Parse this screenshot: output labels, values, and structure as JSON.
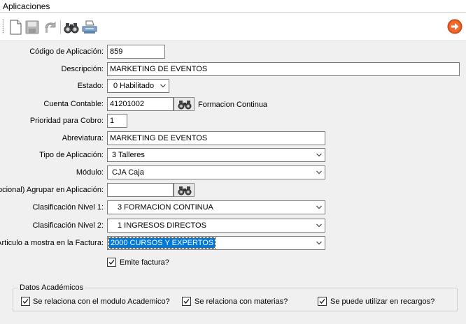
{
  "window": {
    "title": "Aplicaciones"
  },
  "toolbar": {
    "buttons": [
      {
        "name": "new-document-icon"
      },
      {
        "name": "save-icon"
      },
      {
        "name": "undo-icon"
      },
      {
        "name": "binoculars-icon"
      },
      {
        "name": "print-icon"
      }
    ],
    "next": {
      "name": "next-arrow-icon"
    }
  },
  "form": {
    "codigo": {
      "label": "Código de Aplicación:",
      "value": "859"
    },
    "descripcion": {
      "label": "Descripción:",
      "value": "MARKETING DE EVENTOS"
    },
    "estado": {
      "label": "Estado:",
      "value": "0 Habilitado"
    },
    "cuenta": {
      "label": "Cuenta Contable:",
      "value": "41201002",
      "desc": "Formacion Continua"
    },
    "prioridad": {
      "label": "Prioridad para Cobro:",
      "value": "1"
    },
    "abreviatura": {
      "label": "Abreviatura:",
      "value": "MARKETING DE EVENTOS"
    },
    "tipo": {
      "label": "Tipo de Aplicación:",
      "value": "3  Talleres"
    },
    "modulo": {
      "label": "Módulo:",
      "value": "CJA  Caja"
    },
    "agrupar": {
      "label": "(Opcional) Agrupar en Aplicación:",
      "value": ""
    },
    "clasif1": {
      "label": "Clasificación Nivel 1:",
      "value": "3  FORMACION CONTINUA"
    },
    "clasif2": {
      "label": "Clasificación Nivel 2:",
      "value": "1  INGRESOS DIRECTOS"
    },
    "articulo": {
      "label": "Articulo a mostra en la Factura:",
      "value": "2000  CURSOS Y EXPERTOS"
    },
    "emite": {
      "label": "Emite factura?",
      "checked": true
    }
  },
  "academic": {
    "title": "Datos Académicos",
    "checks": [
      {
        "label": "Se relaciona con el modulo Academico?",
        "checked": true
      },
      {
        "label": "Se relaciona con materias?",
        "checked": true
      },
      {
        "label": "Se puede utilizar en recargos?",
        "checked": true
      }
    ]
  },
  "colors": {
    "selection": "#0078d7",
    "accent_next": "#e8561e"
  }
}
